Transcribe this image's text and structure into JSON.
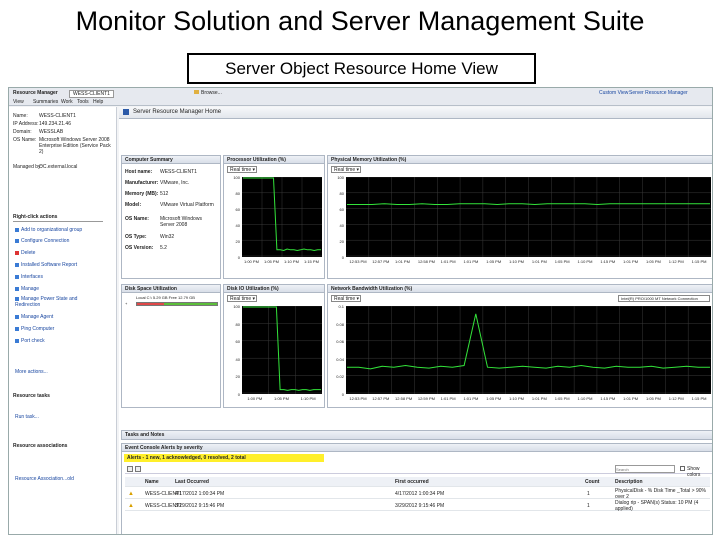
{
  "slide": {
    "title": "Monitor Solution and Server Management  Suite",
    "subtitle": "Server Object Resource Home View"
  },
  "window": {
    "app_name": "Resource Manager",
    "tab_label": "WESS-CLIENT1",
    "browse_label": "Browse...",
    "menu": [
      "View",
      "Summaries",
      "Work",
      "Tools",
      "Help"
    ],
    "top_links": [
      "Custom View",
      "Server Resource Manager"
    ]
  },
  "left": {
    "fields": [
      {
        "label": "Name:",
        "value": "WESS-CLIENT1"
      },
      {
        "label": "IP Address:",
        "value": "149.234.21.46"
      },
      {
        "label": "Domain:",
        "value": "WESSLAB"
      },
      {
        "label": "OS Name:",
        "value": "Microsoft Windows Server 2008 Enterprise Edition (Service Pack 2)"
      },
      {
        "label": "Managed by:",
        "value": "OC.external.local"
      }
    ],
    "actions_heading": "Right-click actions",
    "actions": [
      "Add to organizational group",
      "Configure Connection",
      "Delete",
      "Installed Software Report",
      "Interfaces",
      "Manage",
      "Manage Power State and Redirection",
      "Manage Agent",
      "Ping Computer",
      "Port check"
    ],
    "more_actions": "More actions...",
    "resource_tasks_heading": "Resource tasks",
    "run_task": "Run task...",
    "resource_associations_heading": "Resource associations",
    "association": "Resource Association...old"
  },
  "main": {
    "header": "Server Resource Manager Home",
    "computer_summary": {
      "title": "Computer Summary",
      "rows": [
        {
          "k": "Host name:",
          "v": "WESS-CLIENT1"
        },
        {
          "k": "Manufacturer:",
          "v": "VMware, Inc."
        },
        {
          "k": "Memory (MB):",
          "v": "512"
        },
        {
          "k": "Model:",
          "v": "VMware Virtual Platform"
        },
        {
          "k": "OS Name:",
          "v": "Microsoft Windows Server 2008"
        },
        {
          "k": "OS Type:",
          "v": "Win32"
        },
        {
          "k": "OS Version:",
          "v": "5.2"
        }
      ]
    },
    "disk_space": {
      "title": "Disk Space Utilization",
      "caption": "Local C:\\ 5.29 GB Free 12.79 GB",
      "value": 0.34
    },
    "realtime": "Real time",
    "network_select": "Intel(R) PRO/1000 MT Network Connection",
    "tasks_title": "Tasks and Notes",
    "events_title": "Event Console Alerts by severity",
    "alerts_text": "Alerts - 1 new, 1 acknowledged, 0 resolved, 2 total",
    "search_placeholder": "Search",
    "show_colors": "Show colors",
    "columns": [
      "Name",
      "Last Occurred",
      "First occurred",
      "Count",
      "Description"
    ],
    "alerts": [
      {
        "name": "WESS-CLIENT1",
        "last": "4/17/2012 1:00:34 PM",
        "first": "4/17/2012 1:00:34 PM",
        "count": "1",
        "desc": "PhysicalDisk - % Disk Time _Total > 90% over 2"
      },
      {
        "name": "WESS-CLIENT1",
        "last": "3/29/2012 9:15:46 PM",
        "first": "3/29/2012 9:15:46 PM",
        "count": "1",
        "desc": "Dialog rip - SPAN(s) Status: 10 PM (4 applied)"
      }
    ]
  },
  "chart_data": [
    {
      "type": "line",
      "title": "Processor Utilization (%)",
      "ylim": [
        0,
        100
      ],
      "yticks": [
        "100",
        "80",
        "60",
        "40",
        "20",
        "0"
      ],
      "x": [
        "1:00 PM",
        "1:05 PM",
        "1:10 PM",
        "1:15 PM"
      ],
      "values": [
        100,
        100,
        100,
        100,
        100,
        100,
        100,
        100,
        100,
        100,
        8,
        8,
        7,
        9,
        8,
        8,
        7,
        8,
        9,
        8,
        8,
        7,
        8,
        8
      ]
    },
    {
      "type": "line",
      "title": "Physical Memory Utilization (%)",
      "ylim": [
        0,
        100
      ],
      "yticks": [
        "100",
        "80",
        "60",
        "40",
        "20",
        "0"
      ],
      "x": [
        "12:53 PM",
        "12:57 PM",
        "1:01 PM",
        "12:58 PM",
        "1:01 PM",
        "1:01 PM",
        "1:05 PM",
        "1:10 PM",
        "1:01 PM",
        "1:05 PM",
        "1:10 PM",
        "1:15 PM",
        "1:01 PM",
        "1:05 PM",
        "1:12 PM",
        "1:15 PM"
      ],
      "values": [
        66,
        66,
        66,
        67,
        66,
        66,
        67,
        66,
        66,
        67,
        67,
        67,
        66,
        67,
        67,
        66,
        67,
        67,
        67,
        67,
        66,
        67,
        67,
        67,
        67,
        67,
        67,
        67,
        67,
        67
      ]
    },
    {
      "type": "line",
      "title": "Disk IO Utilization (%)",
      "ylim": [
        0,
        100
      ],
      "yticks": [
        "100",
        "80",
        "60",
        "40",
        "20",
        "0"
      ],
      "x": [
        "1:00 PM",
        "1:05 PM",
        "1:10 PM"
      ],
      "values": [
        100,
        100,
        100,
        100,
        100,
        100,
        100,
        100,
        100,
        100,
        4,
        4,
        3,
        4,
        4,
        3,
        4,
        4,
        3,
        4,
        4,
        4
      ]
    },
    {
      "type": "line",
      "title": "Network Bandwidth Utilization (%)",
      "ylim": [
        0,
        0.1
      ],
      "yticks": [
        "0.1",
        "0.08",
        "0.06",
        "0.04",
        "0.02",
        "0"
      ],
      "x": [
        "12:53 PM",
        "12:57 PM",
        "12:58 PM",
        "12:59 PM",
        "1:01 PM",
        "1:01 PM",
        "1:05 PM",
        "1:10 PM",
        "1:01 PM",
        "1:05 PM",
        "1:10 PM",
        "1:15 PM",
        "1:01 PM",
        "1:05 PM",
        "1:12 PM",
        "1:15 PM"
      ],
      "values": [
        0.03,
        0.03,
        0.028,
        0.031,
        0.03,
        0.032,
        0.03,
        0.029,
        0.031,
        0.03,
        0.032,
        0.092,
        0.03,
        0.029,
        0.03,
        0.031,
        0.03,
        0.029,
        0.031,
        0.03,
        0.032,
        0.03,
        0.029,
        0.031,
        0.03,
        0.03,
        0.031,
        0.029,
        0.03,
        0.031,
        0.03,
        0.03
      ]
    }
  ]
}
